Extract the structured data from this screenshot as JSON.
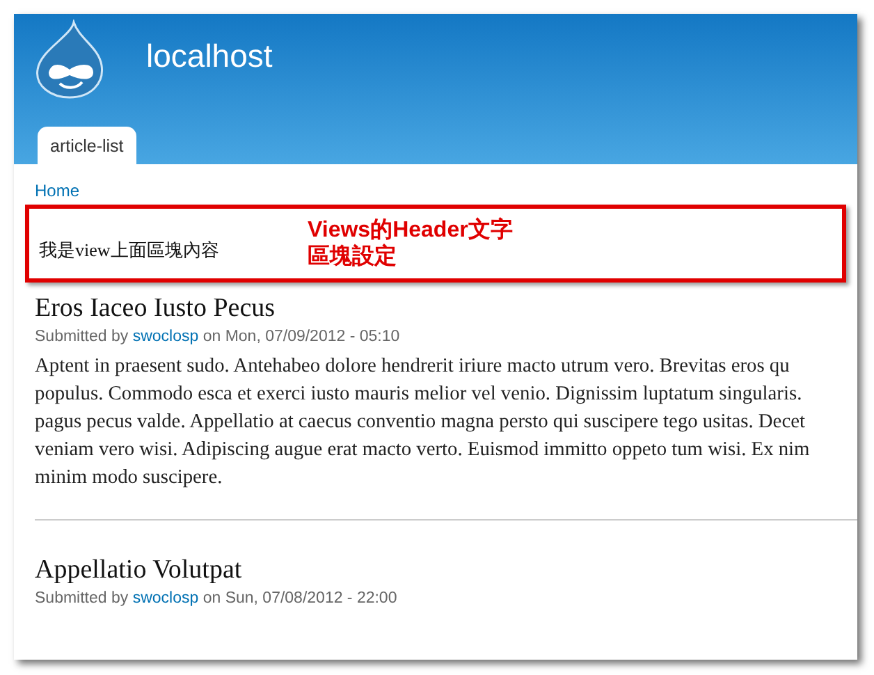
{
  "site": {
    "name": "localhost"
  },
  "tabs": [
    {
      "label": "article-list",
      "selected": true
    }
  ],
  "breadcrumb": "Home",
  "view_header": {
    "text": "我是view上面區塊內容",
    "annotation_lines": [
      "Views的Header文字",
      "區塊設定"
    ]
  },
  "articles": [
    {
      "title": "Eros Iaceo Iusto Pecus",
      "submitted_prefix": "Submitted by",
      "author": "swoclosp",
      "submitted_suffix": "on Mon, 07/09/2012 - 05:10",
      "body_lines": [
        "Aptent in praesent sudo. Antehabeo dolore hendrerit iriure macto utrum vero. Brevitas eros qu",
        "populus. Commodo esca et exerci iusto mauris melior vel venio. Dignissim luptatum singularis.",
        "pagus pecus valde. Appellatio at caecus conventio magna persto qui suscipere tego usitas. Decet",
        "veniam vero wisi. Adipiscing augue erat macto verto. Euismod immitto oppeto tum wisi. Ex nim",
        "minim modo suscipere."
      ]
    },
    {
      "title": "Appellatio Volutpat",
      "submitted_prefix": "Submitted by",
      "author": "swoclosp",
      "submitted_suffix": "on Sun, 07/08/2012 - 22:00"
    }
  ]
}
